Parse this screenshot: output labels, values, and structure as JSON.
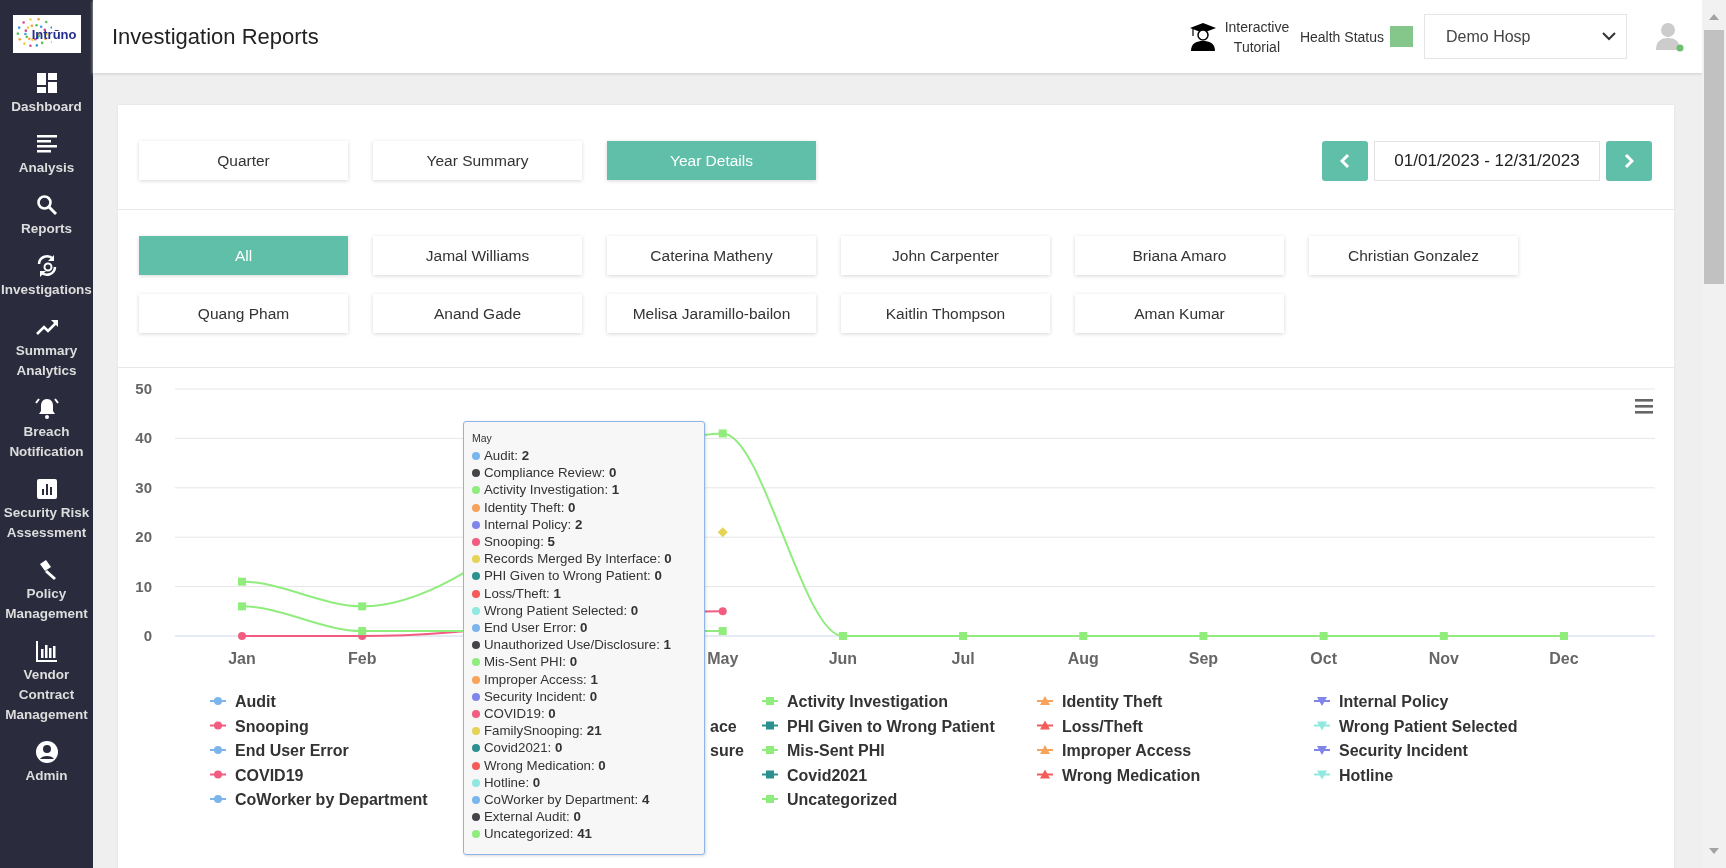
{
  "sidebar": {
    "logo": "Intrūno",
    "items": [
      {
        "label": "Dashboard",
        "kind": "dashboard"
      },
      {
        "label": "Analysis",
        "kind": "analysis"
      },
      {
        "label": "Reports",
        "kind": "reports"
      },
      {
        "label": "Investigations",
        "kind": "investigations"
      },
      {
        "label": "Summary Analytics",
        "kind": "trend"
      },
      {
        "label": "Breach Notification",
        "kind": "bell"
      },
      {
        "label": "Security Risk Assessment",
        "kind": "risk"
      },
      {
        "label": "Policy Management",
        "kind": "gavel"
      },
      {
        "label": "Vendor Contract Management",
        "kind": "vendor"
      },
      {
        "label": "Admin",
        "kind": "admin"
      }
    ]
  },
  "header": {
    "title": "Investigation Reports",
    "tutorial": "Interactive Tutorial",
    "health_status": {
      "label": "Health Status",
      "color": "#85c78a"
    },
    "hospital": "Demo Hosp"
  },
  "period_tabs": [
    {
      "label": "Quarter",
      "selected": false
    },
    {
      "label": "Year Summary",
      "selected": false
    },
    {
      "label": "Year Details",
      "selected": true
    }
  ],
  "date_range": "01/01/2023 - 12/31/2023",
  "users": [
    {
      "label": "All",
      "selected": true
    },
    {
      "label": "Jamal Williams",
      "selected": false
    },
    {
      "label": "Caterina Matheny",
      "selected": false
    },
    {
      "label": "John Carpenter",
      "selected": false
    },
    {
      "label": "Briana Amaro",
      "selected": false
    },
    {
      "label": "Christian Gonzalez",
      "selected": false
    },
    {
      "label": "Quang Pham",
      "selected": false
    },
    {
      "label": "Anand Gade",
      "selected": false
    },
    {
      "label": "Melisa Jaramillo-bailon",
      "selected": false
    },
    {
      "label": "Kaitlin Thompson",
      "selected": false
    },
    {
      "label": "Aman Kumar",
      "selected": false
    }
  ],
  "chart": {
    "chart_data": {
      "type": "line",
      "categories": [
        "Jan",
        "Feb",
        null,
        null,
        "May",
        "Jun",
        "Jul",
        "Aug",
        "Sep",
        "Oct",
        "Nov",
        "Dec"
      ],
      "ylim": [
        0,
        50
      ],
      "yticks": [
        0,
        10,
        20,
        30,
        40,
        50
      ],
      "grid": true,
      "series": [
        {
          "color": "#f15c80",
          "marker": "circle",
          "values": [
            0,
            0,
            null,
            null,
            5,
            null,
            null,
            null,
            null,
            null,
            null,
            null
          ]
        },
        {
          "color": "#90ed7d",
          "marker": "square",
          "values": [
            6,
            1,
            null,
            null,
            1,
            null,
            null,
            null,
            null,
            null,
            null,
            null
          ]
        },
        {
          "color": "#e4d354",
          "marker": "diamond",
          "values": [
            null,
            null,
            null,
            null,
            21,
            null,
            null,
            null,
            null,
            null,
            null,
            null
          ]
        },
        {
          "color": "#90ed7d",
          "marker": "square",
          "values": [
            11,
            6,
            null,
            null,
            41,
            0,
            0,
            0,
            0,
            0,
            0,
            0
          ]
        }
      ]
    },
    "legend": [
      [
        {
          "label": "Audit",
          "color": "#7cb5ec",
          "kind": "circle"
        },
        {
          "label": "Activity Investigation",
          "color": "#90ed7d",
          "kind": "square"
        },
        {
          "label": "Identity Theft",
          "color": "#f7a35c",
          "kind": "triangle"
        },
        {
          "label": "Internal Policy",
          "color": "#8085e9",
          "kind": "triangle-down"
        }
      ],
      [
        {
          "label": "Snooping",
          "color": "#f15c80",
          "kind": "circle"
        },
        {
          "label": "ace",
          "kind": "partial"
        },
        {
          "label": "PHI Given to Wrong Patient",
          "color": "#2b908f",
          "kind": "square"
        },
        {
          "label": "Loss/Theft",
          "color": "#f45b5b",
          "kind": "triangle"
        },
        {
          "label": "Wrong Patient Selected",
          "color": "#91e8e1",
          "kind": "triangle-down"
        }
      ],
      [
        {
          "label": "End User Error",
          "color": "#7cb5ec",
          "kind": "circle"
        },
        {
          "label": "sure",
          "kind": "partial"
        },
        {
          "label": "Mis-Sent PHI",
          "color": "#90ed7d",
          "kind": "square"
        },
        {
          "label": "Improper Access",
          "color": "#f7a35c",
          "kind": "triangle"
        },
        {
          "label": "Security Incident",
          "color": "#8085e9",
          "kind": "triangle-down"
        }
      ],
      [
        {
          "label": "COVID19",
          "color": "#f15c80",
          "kind": "circle"
        },
        {
          "label": "Covid2021",
          "color": "#2b908f",
          "kind": "square"
        },
        {
          "label": "Wrong Medication",
          "color": "#f45b5b",
          "kind": "triangle"
        },
        {
          "label": "Hotline",
          "color": "#91e8e1",
          "kind": "triangle-down"
        }
      ],
      [
        {
          "label": "CoWorker by Department",
          "color": "#7cb5ec",
          "kind": "circle"
        },
        {
          "label": "Uncategorized",
          "color": "#90ed7d",
          "kind": "square"
        }
      ]
    ],
    "tooltip": {
      "title": "May",
      "items": [
        {
          "label": "Audit: ",
          "value": "2",
          "color": "#7cb5ec"
        },
        {
          "label": "Compliance Review: ",
          "value": "0",
          "color": "#434348"
        },
        {
          "label": "Activity Investigation: ",
          "value": "1",
          "color": "#90ed7d"
        },
        {
          "label": "Identity Theft: ",
          "value": "0",
          "color": "#f7a35c"
        },
        {
          "label": "Internal Policy: ",
          "value": "2",
          "color": "#8085e9"
        },
        {
          "label": "Snooping: ",
          "value": "5",
          "color": "#f15c80"
        },
        {
          "label": "Records Merged By Interface: ",
          "value": "0",
          "color": "#e4d354"
        },
        {
          "label": "PHI Given to Wrong Patient: ",
          "value": "0",
          "color": "#2b908f"
        },
        {
          "label": "Loss/Theft: ",
          "value": "1",
          "color": "#f45b5b"
        },
        {
          "label": "Wrong Patient Selected: ",
          "value": "0",
          "color": "#91e8e1"
        },
        {
          "label": "End User Error: ",
          "value": "0",
          "color": "#7cb5ec"
        },
        {
          "label": "Unauthorized Use/Disclosure: ",
          "value": "1",
          "color": "#434348"
        },
        {
          "label": "Mis-Sent PHI: ",
          "value": "0",
          "color": "#90ed7d"
        },
        {
          "label": "Improper Access: ",
          "value": "1",
          "color": "#f7a35c"
        },
        {
          "label": "Security Incident: ",
          "value": "0",
          "color": "#8085e9"
        },
        {
          "label": "COVID19: ",
          "value": "0",
          "color": "#f15c80"
        },
        {
          "label": "FamilySnooping: ",
          "value": "21",
          "color": "#e4d354"
        },
        {
          "label": "Covid2021: ",
          "value": "0",
          "color": "#2b908f"
        },
        {
          "label": "Wrong Medication: ",
          "value": "0",
          "color": "#f45b5b"
        },
        {
          "label": "Hotline: ",
          "value": "0",
          "color": "#91e8e1"
        },
        {
          "label": "CoWorker by Department: ",
          "value": "4",
          "color": "#7cb5ec"
        },
        {
          "label": "External Audit: ",
          "value": "0",
          "color": "#434348"
        },
        {
          "label": "Uncategorized: ",
          "value": "41",
          "color": "#90ed7d"
        }
      ]
    }
  }
}
